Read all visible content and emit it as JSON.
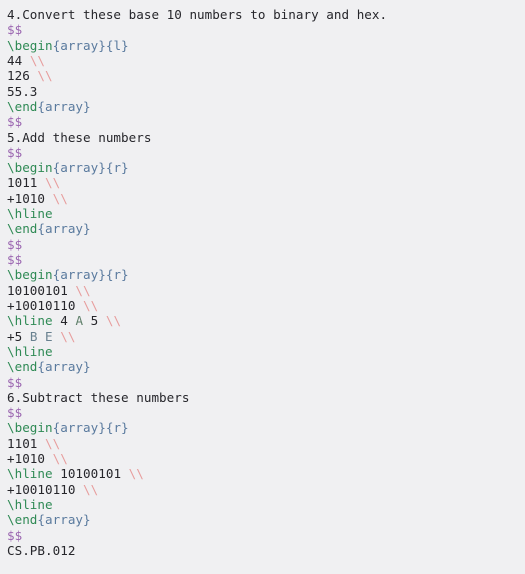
{
  "document": {
    "name": "latex-source-view",
    "background_color": "#f0f0f2",
    "plain_text_color": "#26262b",
    "colors": {
      "math_delimiter": "#9a65b0",
      "command": "#2f8a55",
      "brace_arg": "#5a7a9e",
      "line_break": "#e79d9d",
      "plain": "#26262b"
    },
    "footer_label": "CS.PB.012",
    "lines": [
      {
        "id": 1,
        "tokens": [
          {
            "t": "4.Convert these base 10 numbers to binary and hex.",
            "c": "t-plain"
          }
        ]
      },
      {
        "id": 2,
        "tokens": [
          {
            "t": "$$",
            "c": "t-math"
          }
        ]
      },
      {
        "id": 3,
        "tokens": [
          {
            "t": "\\begin",
            "c": "t-cmd"
          },
          {
            "t": "{array}{l}",
            "c": "t-brace"
          }
        ]
      },
      {
        "id": 4,
        "tokens": [
          {
            "t": "44 ",
            "c": "t-plain"
          },
          {
            "t": "\\\\",
            "c": "t-nl"
          }
        ]
      },
      {
        "id": 5,
        "tokens": [
          {
            "t": "126 ",
            "c": "t-plain"
          },
          {
            "t": "\\\\",
            "c": "t-nl"
          }
        ]
      },
      {
        "id": 6,
        "tokens": [
          {
            "t": "55.3",
            "c": "t-plain"
          }
        ]
      },
      {
        "id": 7,
        "tokens": [
          {
            "t": "\\end",
            "c": "t-cmd"
          },
          {
            "t": "{array}",
            "c": "t-brace"
          }
        ]
      },
      {
        "id": 8,
        "tokens": [
          {
            "t": "$$",
            "c": "t-math"
          }
        ]
      },
      {
        "id": 9,
        "tokens": [
          {
            "t": "5.Add these numbers",
            "c": "t-plain"
          }
        ]
      },
      {
        "id": 10,
        "tokens": [
          {
            "t": "$$",
            "c": "t-math"
          }
        ]
      },
      {
        "id": 11,
        "tokens": [
          {
            "t": "\\begin",
            "c": "t-cmd"
          },
          {
            "t": "{array}{r}",
            "c": "t-brace"
          }
        ]
      },
      {
        "id": 12,
        "tokens": [
          {
            "t": "1011 ",
            "c": "t-plain"
          },
          {
            "t": "\\\\",
            "c": "t-nl"
          }
        ]
      },
      {
        "id": 13,
        "tokens": [
          {
            "t": "+1010 ",
            "c": "t-plain"
          },
          {
            "t": "\\\\",
            "c": "t-nl"
          }
        ]
      },
      {
        "id": 14,
        "tokens": [
          {
            "t": "\\hline",
            "c": "t-cmd"
          }
        ]
      },
      {
        "id": 15,
        "tokens": [
          {
            "t": "\\end",
            "c": "t-cmd"
          },
          {
            "t": "{array}",
            "c": "t-brace"
          }
        ]
      },
      {
        "id": 16,
        "tokens": [
          {
            "t": "$$",
            "c": "t-math"
          }
        ]
      },
      {
        "id": 17,
        "tokens": [
          {
            "t": "$$",
            "c": "t-math"
          }
        ]
      },
      {
        "id": 18,
        "tokens": [
          {
            "t": "\\begin",
            "c": "t-cmd"
          },
          {
            "t": "{array}{r}",
            "c": "t-brace"
          }
        ]
      },
      {
        "id": 19,
        "tokens": [
          {
            "t": "10100101 ",
            "c": "t-plain"
          },
          {
            "t": "\\\\",
            "c": "t-nl"
          }
        ]
      },
      {
        "id": 20,
        "tokens": [
          {
            "t": "+10010110 ",
            "c": "t-plain"
          },
          {
            "t": "\\\\",
            "c": "t-nl"
          }
        ]
      },
      {
        "id": 21,
        "tokens": [
          {
            "t": "\\hline",
            "c": "t-cmd"
          },
          {
            "t": " 4 ",
            "c": "t-plain"
          },
          {
            "t": "A",
            "c": "t-hexlet"
          },
          {
            "t": " 5 ",
            "c": "t-plain"
          },
          {
            "t": "\\\\",
            "c": "t-nl"
          }
        ]
      },
      {
        "id": 22,
        "tokens": [
          {
            "t": "+5 ",
            "c": "t-plain"
          },
          {
            "t": "B E",
            "c": "t-hexlet2"
          },
          {
            "t": " ",
            "c": "t-plain"
          },
          {
            "t": "\\\\",
            "c": "t-nl"
          }
        ]
      },
      {
        "id": 23,
        "tokens": [
          {
            "t": "\\hline",
            "c": "t-cmd"
          }
        ]
      },
      {
        "id": 24,
        "tokens": [
          {
            "t": "\\end",
            "c": "t-cmd"
          },
          {
            "t": "{array}",
            "c": "t-brace"
          }
        ]
      },
      {
        "id": 25,
        "tokens": [
          {
            "t": "$$",
            "c": "t-math"
          }
        ]
      },
      {
        "id": 26,
        "tokens": [
          {
            "t": "6.Subtract these numbers",
            "c": "t-plain"
          }
        ]
      },
      {
        "id": 27,
        "tokens": [
          {
            "t": "$$",
            "c": "t-math"
          }
        ]
      },
      {
        "id": 28,
        "tokens": [
          {
            "t": "\\begin",
            "c": "t-cmd"
          },
          {
            "t": "{array}{r}",
            "c": "t-brace"
          }
        ]
      },
      {
        "id": 29,
        "tokens": [
          {
            "t": "1101 ",
            "c": "t-plain"
          },
          {
            "t": "\\\\",
            "c": "t-nl"
          }
        ]
      },
      {
        "id": 30,
        "tokens": [
          {
            "t": "+1010 ",
            "c": "t-plain"
          },
          {
            "t": "\\\\",
            "c": "t-nl"
          }
        ]
      },
      {
        "id": 31,
        "tokens": [
          {
            "t": "\\hline",
            "c": "t-cmd"
          },
          {
            "t": " 10100101 ",
            "c": "t-plain"
          },
          {
            "t": "\\\\",
            "c": "t-nl"
          }
        ]
      },
      {
        "id": 32,
        "tokens": [
          {
            "t": "+10010110 ",
            "c": "t-plain"
          },
          {
            "t": "\\\\",
            "c": "t-nl"
          }
        ]
      },
      {
        "id": 33,
        "tokens": [
          {
            "t": "\\hline",
            "c": "t-cmd"
          }
        ]
      },
      {
        "id": 34,
        "tokens": [
          {
            "t": "\\end",
            "c": "t-cmd"
          },
          {
            "t": "{array}",
            "c": "t-brace"
          }
        ]
      },
      {
        "id": 35,
        "tokens": [
          {
            "t": "$$",
            "c": "t-math"
          }
        ]
      },
      {
        "id": 36,
        "tokens": [
          {
            "t": "CS.PB.012",
            "c": "t-plain"
          }
        ]
      }
    ]
  }
}
